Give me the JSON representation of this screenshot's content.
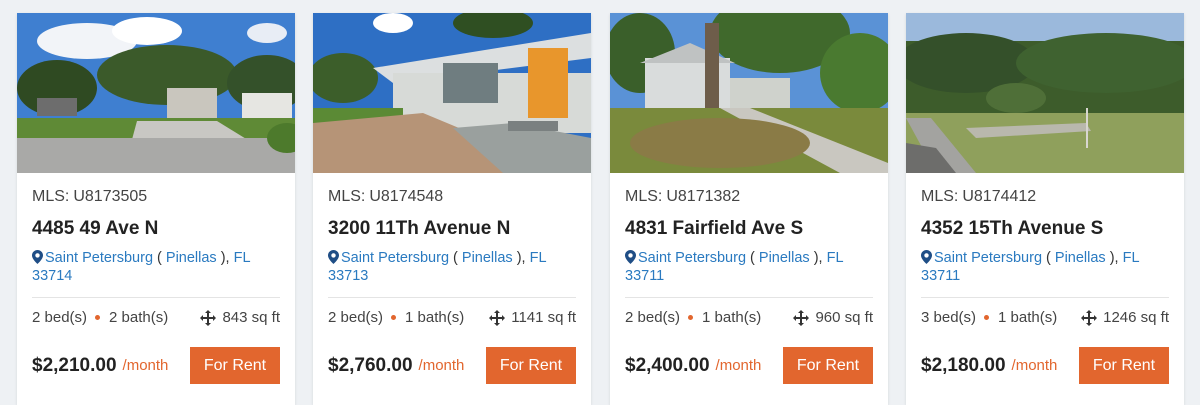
{
  "colors": {
    "accent": "#e2662e",
    "link": "#2a7ac0",
    "background": "#eef1f4"
  },
  "icons": {
    "location": "map-pin-icon",
    "area": "move-arrows-icon"
  },
  "listings": [
    {
      "mls_label": "MLS:",
      "mls": "U8173505",
      "address": "4485 49 Ave N",
      "city": "Saint Petersburg",
      "county": "Pinellas",
      "state": "FL",
      "zip": "33714",
      "beds": "2 bed(s)",
      "baths": "2 bath(s)",
      "sqft": "843 sq ft",
      "price": "$2,210.00",
      "period": "/month",
      "button": "For Rent"
    },
    {
      "mls_label": "MLS:",
      "mls": "U8174548",
      "address": "3200 11Th Avenue N",
      "city": "Saint Petersburg",
      "county": "Pinellas",
      "state": "FL",
      "zip": "33713",
      "beds": "2 bed(s)",
      "baths": "1 bath(s)",
      "sqft": "1141 sq ft",
      "price": "$2,760.00",
      "period": "/month",
      "button": "For Rent"
    },
    {
      "mls_label": "MLS:",
      "mls": "U8171382",
      "address": "4831 Fairfield Ave S",
      "city": "Saint Petersburg",
      "county": "Pinellas",
      "state": "FL",
      "zip": "33711",
      "beds": "2 bed(s)",
      "baths": "1 bath(s)",
      "sqft": "960 sq ft",
      "price": "$2,400.00",
      "period": "/month",
      "button": "For Rent"
    },
    {
      "mls_label": "MLS:",
      "mls": "U8174412",
      "address": "4352 15Th Avenue S",
      "city": "Saint Petersburg",
      "county": "Pinellas",
      "state": "FL",
      "zip": "33711",
      "beds": "3 bed(s)",
      "baths": "1 bath(s)",
      "sqft": "1246 sq ft",
      "price": "$2,180.00",
      "period": "/month",
      "button": "For Rent"
    }
  ]
}
